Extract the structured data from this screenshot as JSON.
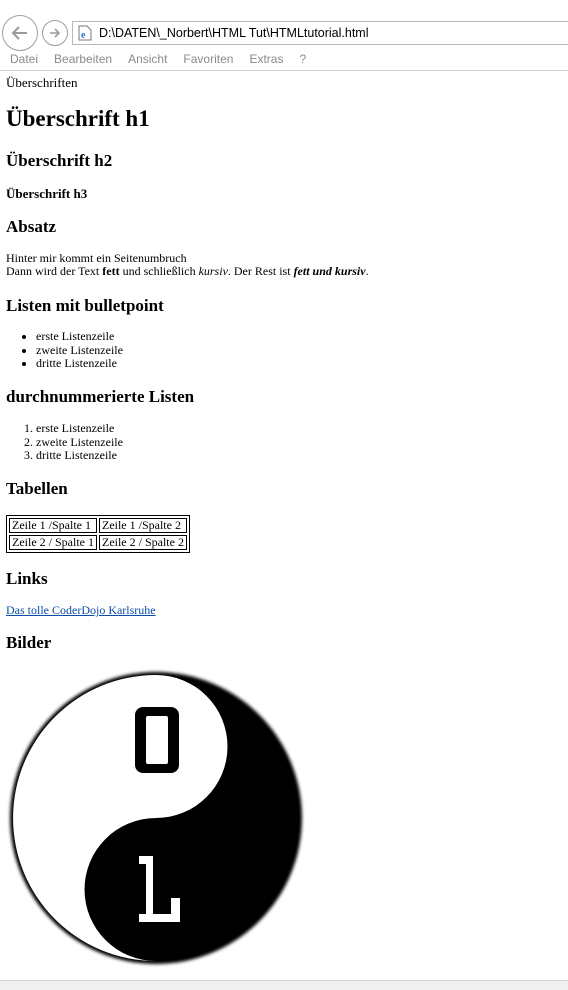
{
  "browser": {
    "address": "D:\\DATEN\\_Norbert\\HTML Tut\\HTMLtutorial.html",
    "menu": [
      "Datei",
      "Bearbeiten",
      "Ansicht",
      "Favoriten",
      "Extras",
      "?"
    ]
  },
  "page": {
    "title_text": "Überschriften",
    "h1": "Überschrift h1",
    "h2": "Überschrift h2",
    "h3": "Überschrift h3",
    "absatz_heading": "Absatz",
    "absatz": {
      "line1": "Hinter mir kommt ein Seitenumbruch",
      "line2_a": "Dann wird der Text ",
      "bold": "fett",
      "line2_b": " und schließlich ",
      "italic": "kursiv",
      "line2_c": ". Der Rest ist ",
      "bold_italic": "fett und kursiv",
      "line2_d": "."
    },
    "bullets_heading": "Listen mit bulletpoint",
    "bullets": [
      "erste Listenzeile",
      "zweite Listenzeile",
      "dritte Listenzeile"
    ],
    "numbered_heading": "durchnummerierte Listen",
    "numbered": [
      "erste Listenzeile",
      "zweite Listenzeile",
      "dritte Listenzeile"
    ],
    "tables_heading": "Tabellen",
    "table": [
      [
        "Zeile 1 /Spalte 1",
        "Zeile 1 /Spalte 2"
      ],
      [
        "Zeile 2 / Spalte 1",
        "Zeile 2 / Spalte 2"
      ]
    ],
    "links_heading": "Links",
    "link_text": "Das tolle CoderDojo Karlsruhe",
    "images_heading": "Bilder"
  },
  "colors": {
    "link": "#0b4ea8",
    "menu": "#8a8a8a"
  },
  "icons": [
    "back-arrow-icon",
    "forward-arrow-icon",
    "ie-page-icon",
    "yin-yang-01-logo"
  ]
}
